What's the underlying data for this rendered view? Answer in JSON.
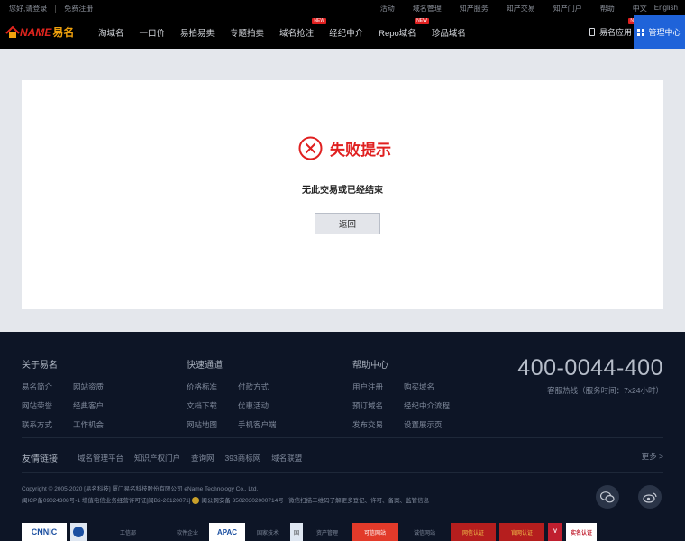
{
  "topbar": {
    "welcome": "您好,请登录",
    "register": "免费注册",
    "links": [
      "活动",
      "域名管理",
      "知产服务",
      "知产交易",
      "知产门户",
      "帮助"
    ],
    "lang_cn": "中文",
    "lang_en": "English"
  },
  "nav": {
    "logo_text": "NAME",
    "logo_text2": "易名",
    "items": [
      {
        "label": "淘域名"
      },
      {
        "label": "一口价"
      },
      {
        "label": "易拍易卖"
      },
      {
        "label": "专题拍卖"
      },
      {
        "label": "域名抢注",
        "badge": "NEW"
      },
      {
        "label": "经纪中介"
      },
      {
        "label": "Repo域名",
        "badge": "NEW"
      },
      {
        "label": "珍品域名"
      }
    ],
    "app_label": "易名应用",
    "app_badge": "NEW",
    "admin_label": "管理中心"
  },
  "main": {
    "title": "失败提示",
    "message": "无此交易或已经结束",
    "back_label": "返回"
  },
  "footer": {
    "about": {
      "title": "关于易名",
      "rows": [
        [
          "易名简介",
          "网站资质"
        ],
        [
          "网站荣誉",
          "经典客户"
        ],
        [
          "联系方式",
          "工作机会"
        ]
      ]
    },
    "quick": {
      "title": "快速通道",
      "rows": [
        [
          "价格标准",
          "付款方式"
        ],
        [
          "文档下载",
          "优惠活动"
        ],
        [
          "网站地图",
          "手机客户端"
        ]
      ]
    },
    "help": {
      "title": "帮助中心",
      "rows": [
        [
          "用户注册",
          "购买域名"
        ],
        [
          "预订域名",
          "经纪中介流程"
        ],
        [
          "发布交易",
          "设置展示页"
        ]
      ]
    },
    "hotline": "400-0044-400",
    "hotline_sub": "客服热线（服务时间：7x24小时）",
    "friends_title": "友情链接",
    "friends": [
      "域名管理平台",
      "知识产权门户",
      "查询网",
      "393商标网",
      "域名联盟"
    ],
    "more": "更多 >",
    "copyright": "Copyright © 2005-2020 [易名科技] 厦门易名科技股份有限公司 eName Technology Co., Ltd.",
    "icp": "闽ICP备09024308号-1  增值电信业务经营许可证[闽B2-20120071]",
    "police": "闽公网安备 35020302000714号",
    "wechat_note": "微信扫描二维码了解更多登记、许可、备案、监管信息",
    "badges": [
      "CNNIC",
      "工信部",
      "软件企业",
      "APAC",
      "国家技术",
      "国",
      "资产管理",
      "可信网站",
      "诚信网站",
      "网信认证",
      "官网认证",
      "V",
      "实名认证"
    ],
    "colors": {
      "accent": "#1f63d9",
      "error": "#e02020"
    }
  }
}
